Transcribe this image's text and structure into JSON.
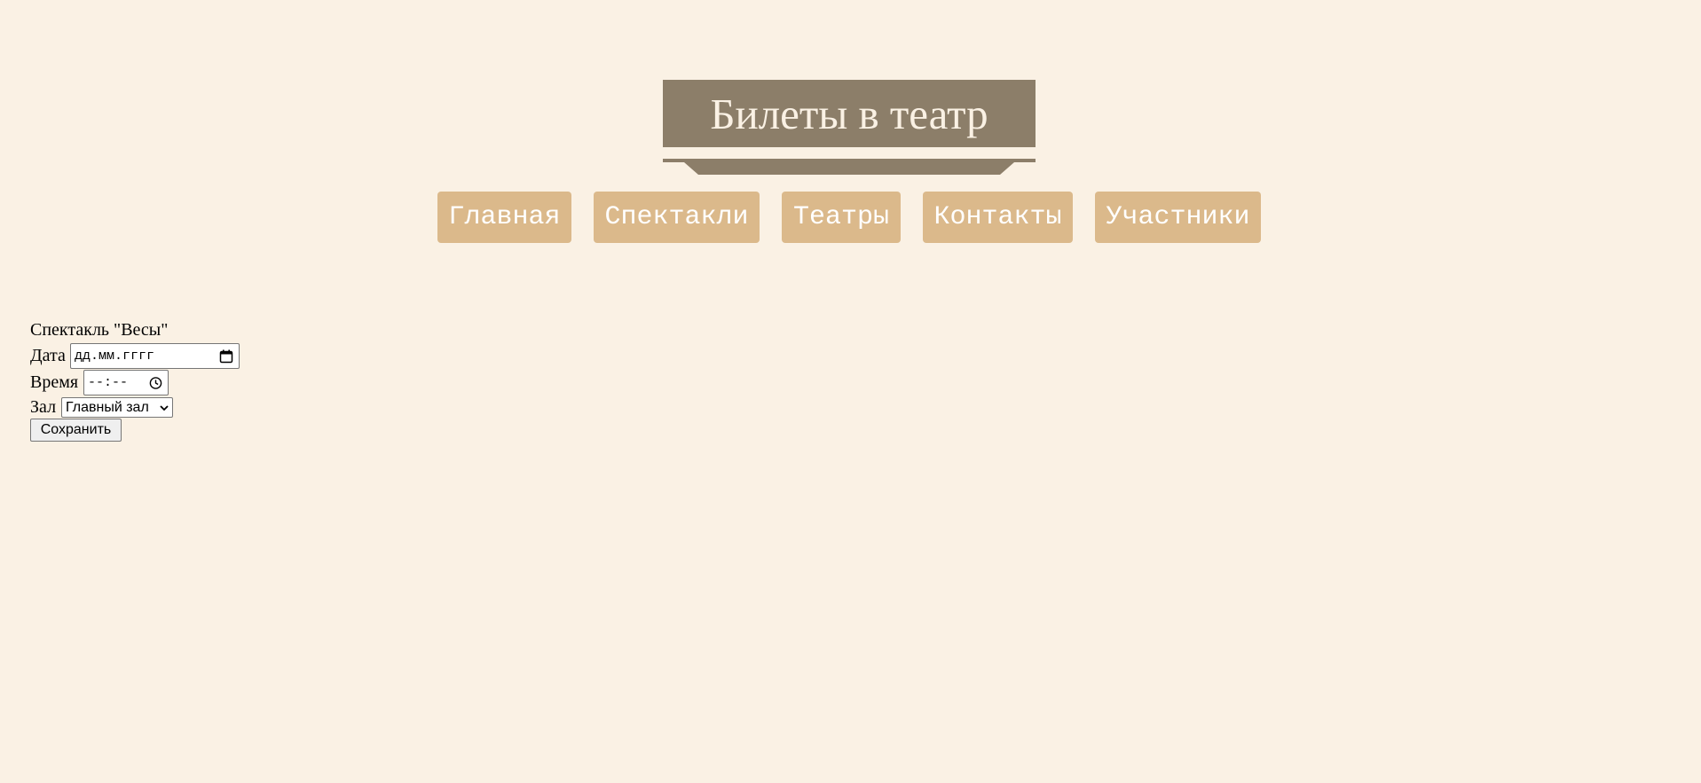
{
  "header": {
    "title": "Билеты в театр"
  },
  "nav": {
    "items": [
      {
        "label": "Главная"
      },
      {
        "label": "Спектакли"
      },
      {
        "label": "Театры"
      },
      {
        "label": "Контакты"
      },
      {
        "label": "Участники"
      }
    ]
  },
  "form": {
    "title": "Спектакль \"Весы\"",
    "date": {
      "label": "Дата",
      "placeholder": "дд.мм.гггг"
    },
    "time": {
      "label": "Время",
      "placeholder": "--:--"
    },
    "hall": {
      "label": "Зал",
      "selected": "Главный зал"
    },
    "save_label": "Сохранить"
  },
  "colors": {
    "background": "#faf1e4",
    "header_bg": "#8c7e69",
    "header_text": "#faf1e4",
    "nav_button_bg": "#dbb98b",
    "nav_button_text": "#ffffff"
  }
}
